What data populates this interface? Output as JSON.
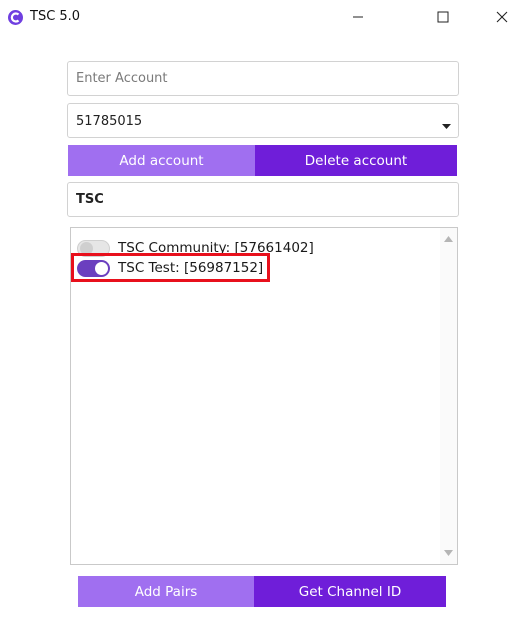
{
  "window": {
    "title": "TSC 5.0"
  },
  "account_input": {
    "placeholder": "Enter Account",
    "value": ""
  },
  "account_select": {
    "value": "51785015"
  },
  "buttons": {
    "add_account": "Add account",
    "delete_account": "Delete account",
    "add_pairs": "Add Pairs",
    "get_channel_id": "Get Channel ID"
  },
  "filter_input": {
    "value": "TSC"
  },
  "channels": [
    {
      "label": "TSC Community: [57661402]",
      "enabled": false
    },
    {
      "label": "TSC Test: [56987152]",
      "enabled": true
    }
  ],
  "colors": {
    "button_light": "#a06ff0",
    "button_dark": "#6f1ed9",
    "toggle_on": "#6b3fbf",
    "highlight": "#e8101c"
  }
}
